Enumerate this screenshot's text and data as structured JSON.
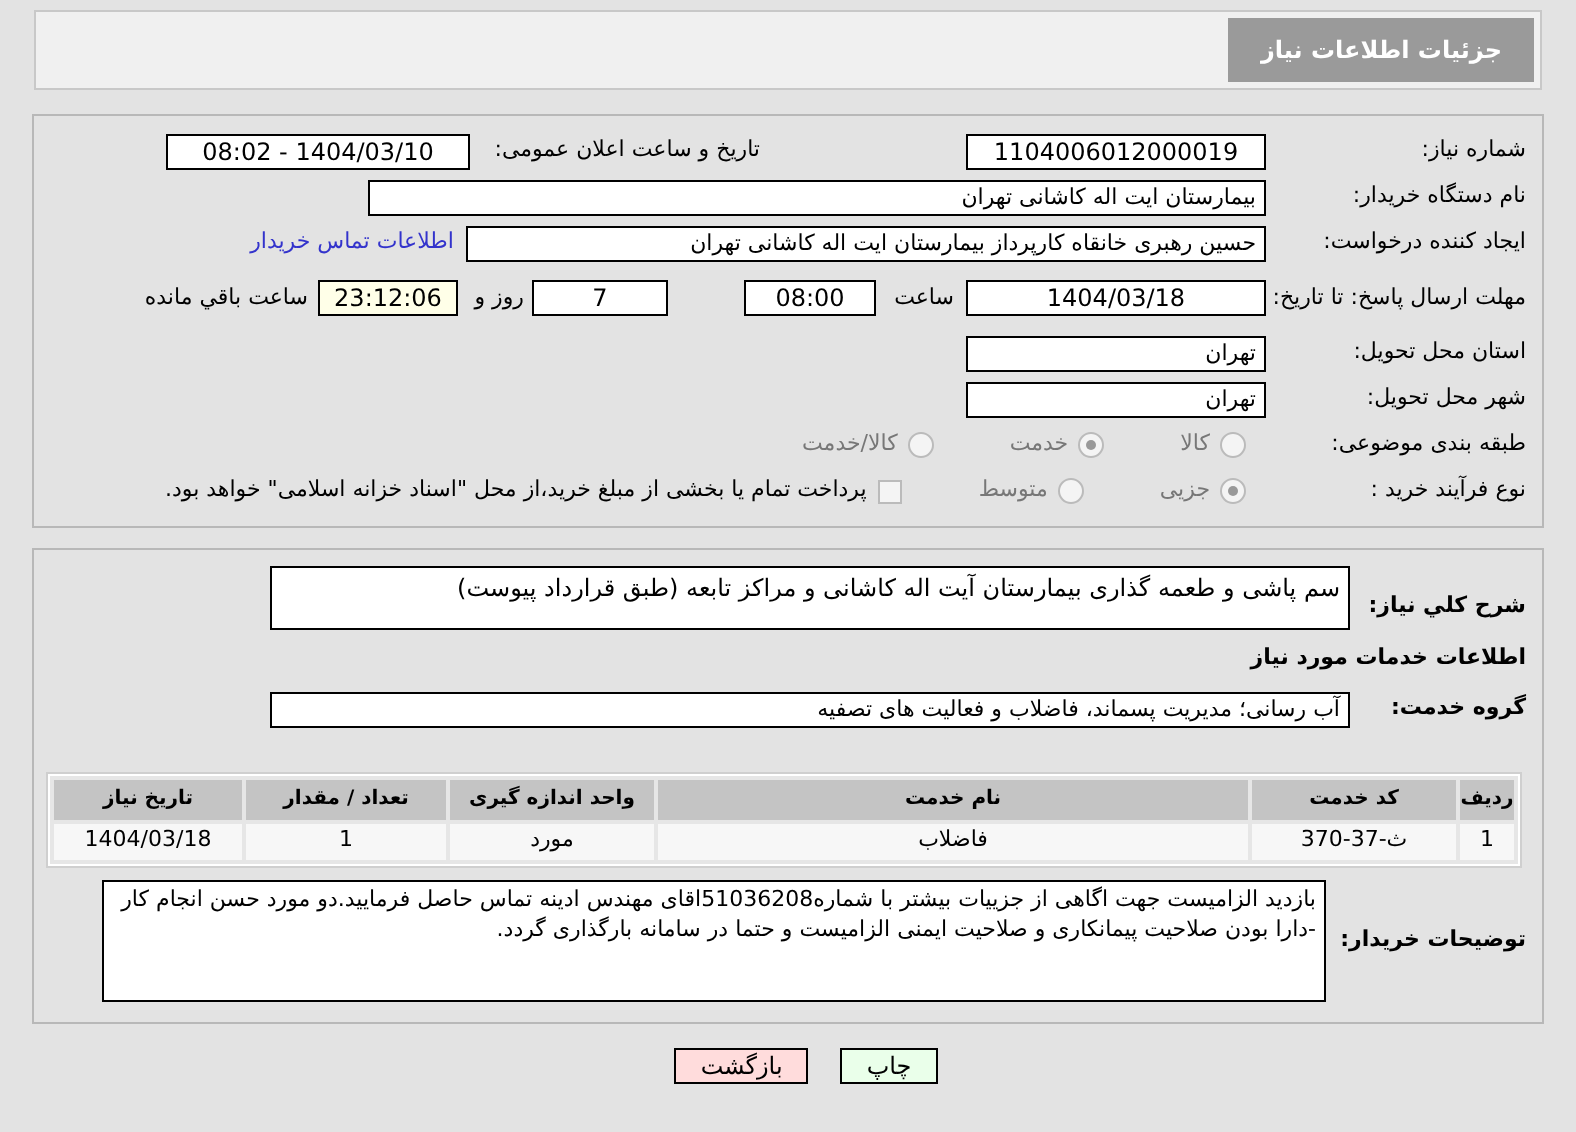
{
  "header": {
    "title": "جزئیات اطلاعات نیاز"
  },
  "request": {
    "number_label": "شماره نیاز:",
    "number": "1104006012000019",
    "announce_label": "تاریخ و ساعت اعلان عمومی:",
    "announce": "1404/03/10 - 08:02",
    "buyer_label": "نام دستگاه خریدار:",
    "buyer": "بیمارستان ایت اله کاشانی تهران",
    "creator_label": "ایجاد کننده درخواست:",
    "creator": "حسین رهبری خانقاه کارپرداز بیمارستان ایت اله کاشانی تهران",
    "contact_link": "اطلاعات تماس خریدار",
    "deadline_label": "مهلت ارسال پاسخ: تا تاریخ:",
    "deadline_date": "1404/03/18",
    "time_label": "ساعت",
    "deadline_time": "08:00",
    "days": "7",
    "days_label": "روز و",
    "remaining": "23:12:06",
    "remaining_label": "ساعت باقي مانده",
    "province_label": "استان محل تحویل:",
    "province": "تهران",
    "city_label": "شهر محل تحویل:",
    "city": "تهران",
    "category_label": "طبقه بندی موضوعی:",
    "categories": [
      {
        "label": "کالا",
        "selected": false
      },
      {
        "label": "خدمت",
        "selected": true
      },
      {
        "label": "کالا/خدمت",
        "selected": false
      }
    ],
    "process_label": "نوع فرآیند خرید :",
    "processes": [
      {
        "label": "جزیی",
        "selected": true
      },
      {
        "label": "متوسط",
        "selected": false
      }
    ],
    "treasury": {
      "label": "پرداخت تمام یا بخشی از مبلغ خرید،از محل \"اسناد خزانه اسلامی\" خواهد بود.",
      "checked": false
    }
  },
  "details": {
    "summary_label": "شرح کلي نياز:",
    "summary": "سم پاشی و طعمه گذاری بیمارستان آیت اله کاشانی و مراکز تابعه (طبق قرارداد پیوست)",
    "services_heading": "اطلاعات خدمات مورد نیاز",
    "group_label": "گروه خدمت:",
    "group": "آب رسانی؛ مدیریت پسماند، فاضلاب و فعالیت های تصفیه",
    "table": {
      "columns": [
        "ردیف",
        "کد خدمت",
        "نام خدمت",
        "واحد اندازه گیری",
        "تعداد / مقدار",
        "تاریخ نیاز"
      ],
      "rows": [
        [
          "1",
          "ث-37-370",
          "فاضلاب",
          "مورد",
          "1",
          "1404/03/18"
        ]
      ]
    },
    "notes_label": "توضیحات خریدار:",
    "notes": "بازدید الزامیست جهت اگاهی از جزییات بیشتر با شماره51036208اقای مهندس ادینه تماس حاصل فرمایید.دو مورد حسن انجام کار -دارا بودن صلاحیت پیمانکاری و صلاحیت ایمنی الزامیست و حتما در سامانه بارگذاری گردد."
  },
  "buttons": [
    {
      "label": "چاپ",
      "kind": "print"
    },
    {
      "label": "بازگشت",
      "kind": "back"
    }
  ]
}
